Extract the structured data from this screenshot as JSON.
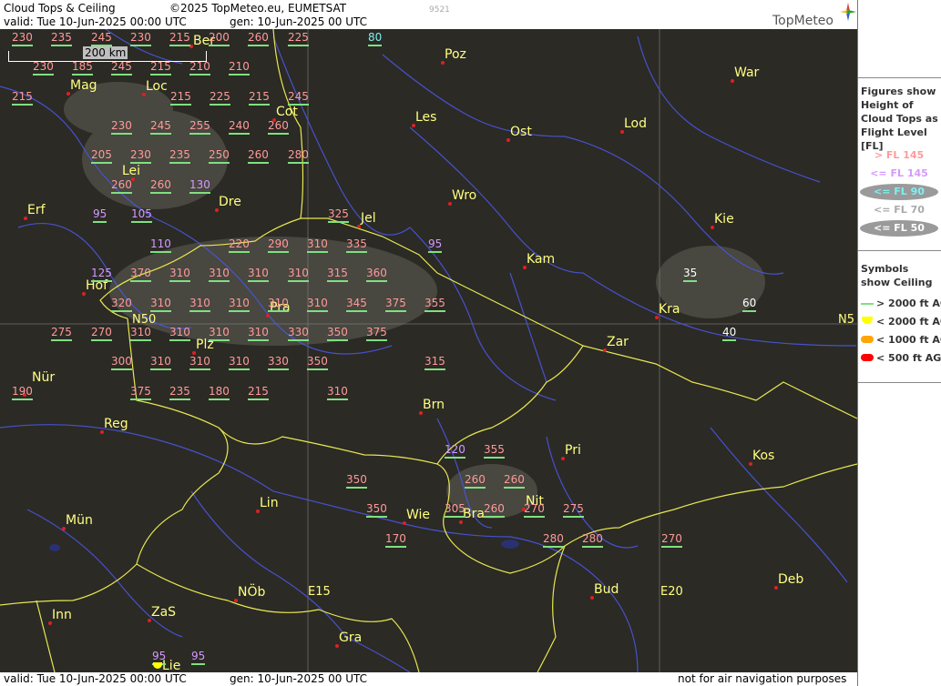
{
  "header": {
    "title": "Cloud Tops & Ceiling",
    "copyright": "©2025 TopMeteo.eu, EUMETSAT",
    "image_code": "9521",
    "valid": "valid:   Tue   10-Jun-2025   00:00 UTC",
    "generated": "gen: 10-Jun-2025 00 UTC",
    "brand": "TopMeteo"
  },
  "footer": {
    "valid": "valid:   Tue   10-Jun-2025   00:00 UTC",
    "generated": "gen: 10-Jun-2025 00 UTC",
    "disclaimer": "not for air navigation purposes"
  },
  "scale": {
    "label": "200 km"
  },
  "graticule": {
    "n50": "N50",
    "n50_right": "N5",
    "e15": "E15",
    "e20": "E20"
  },
  "colors": {
    "high": "#ff9a9a",
    "mid": "#d39aff",
    "low": "#7ff0f0",
    "lower": "#ffffff",
    "ceiling_ok": "#80e080",
    "ceiling_2000": "#ffff00",
    "ceiling_1000": "#ffa500",
    "ceiling_500": "#ff0000"
  },
  "cities": [
    {
      "name": "Ber"
    },
    {
      "name": "Poz"
    },
    {
      "name": "War"
    },
    {
      "name": "Mag"
    },
    {
      "name": "Loc"
    },
    {
      "name": "Cot"
    },
    {
      "name": "Les"
    },
    {
      "name": "Lod"
    },
    {
      "name": "Ost"
    },
    {
      "name": "Lei"
    },
    {
      "name": "Dre"
    },
    {
      "name": "Erf"
    },
    {
      "name": "Wro"
    },
    {
      "name": "Jel"
    },
    {
      "name": "Kie"
    },
    {
      "name": "Kam"
    },
    {
      "name": "Hof"
    },
    {
      "name": "Pra"
    },
    {
      "name": "Kra"
    },
    {
      "name": "Zar"
    },
    {
      "name": "Plz"
    },
    {
      "name": "Nür"
    },
    {
      "name": "Brn"
    },
    {
      "name": "Reg"
    },
    {
      "name": "Pri"
    },
    {
      "name": "Kos"
    },
    {
      "name": "Lin"
    },
    {
      "name": "Nit"
    },
    {
      "name": "Wie"
    },
    {
      "name": "Bra"
    },
    {
      "name": "Mün"
    },
    {
      "name": "NÖb"
    },
    {
      "name": "Bud"
    },
    {
      "name": "Deb"
    },
    {
      "name": "Inn"
    },
    {
      "name": "ZaS"
    },
    {
      "name": "Gra"
    },
    {
      "name": "Lie"
    }
  ],
  "cloud_tops": [
    {
      "v": "230",
      "c": "pink"
    },
    {
      "v": "235",
      "c": "pink"
    },
    {
      "v": "245",
      "c": "pink"
    },
    {
      "v": "230",
      "c": "pink"
    },
    {
      "v": "215",
      "c": "pink"
    },
    {
      "v": "200",
      "c": "pink"
    },
    {
      "v": "260",
      "c": "pink"
    },
    {
      "v": "225",
      "c": "pink"
    },
    {
      "v": "80",
      "c": "cyan"
    },
    {
      "v": "230",
      "c": "pink"
    },
    {
      "v": "185",
      "c": "pink"
    },
    {
      "v": "245",
      "c": "pink"
    },
    {
      "v": "215",
      "c": "pink"
    },
    {
      "v": "210",
      "c": "pink"
    },
    {
      "v": "210",
      "c": "pink"
    },
    {
      "v": "215",
      "c": "pink"
    },
    {
      "v": "215",
      "c": "pink"
    },
    {
      "v": "225",
      "c": "pink"
    },
    {
      "v": "215",
      "c": "pink"
    },
    {
      "v": "245",
      "c": "pink"
    },
    {
      "v": "230",
      "c": "pink"
    },
    {
      "v": "245",
      "c": "pink"
    },
    {
      "v": "255",
      "c": "pink"
    },
    {
      "v": "240",
      "c": "pink"
    },
    {
      "v": "260",
      "c": "pink"
    },
    {
      "v": "205",
      "c": "pink"
    },
    {
      "v": "230",
      "c": "pink"
    },
    {
      "v": "235",
      "c": "pink"
    },
    {
      "v": "250",
      "c": "pink"
    },
    {
      "v": "260",
      "c": "pink"
    },
    {
      "v": "280",
      "c": "pink"
    },
    {
      "v": "260",
      "c": "pink"
    },
    {
      "v": "260",
      "c": "pink"
    },
    {
      "v": "130",
      "c": "violet"
    },
    {
      "v": "95",
      "c": "violet"
    },
    {
      "v": "105",
      "c": "violet"
    },
    {
      "v": "325",
      "c": "pink"
    },
    {
      "v": "110",
      "c": "violet"
    },
    {
      "v": "220",
      "c": "pink"
    },
    {
      "v": "290",
      "c": "pink"
    },
    {
      "v": "310",
      "c": "pink"
    },
    {
      "v": "335",
      "c": "pink"
    },
    {
      "v": "95",
      "c": "violet"
    },
    {
      "v": "125",
      "c": "violet"
    },
    {
      "v": "370",
      "c": "pink"
    },
    {
      "v": "310",
      "c": "pink"
    },
    {
      "v": "310",
      "c": "pink"
    },
    {
      "v": "310",
      "c": "pink"
    },
    {
      "v": "310",
      "c": "pink"
    },
    {
      "v": "315",
      "c": "pink"
    },
    {
      "v": "360",
      "c": "pink"
    },
    {
      "v": "35",
      "c": "white"
    },
    {
      "v": "320",
      "c": "pink"
    },
    {
      "v": "310",
      "c": "pink"
    },
    {
      "v": "310",
      "c": "pink"
    },
    {
      "v": "310",
      "c": "pink"
    },
    {
      "v": "310",
      "c": "pink"
    },
    {
      "v": "310",
      "c": "pink"
    },
    {
      "v": "345",
      "c": "pink"
    },
    {
      "v": "375",
      "c": "pink"
    },
    {
      "v": "355",
      "c": "pink"
    },
    {
      "v": "60",
      "c": "white"
    },
    {
      "v": "275",
      "c": "pink"
    },
    {
      "v": "270",
      "c": "pink"
    },
    {
      "v": "310",
      "c": "pink"
    },
    {
      "v": "310",
      "c": "pink"
    },
    {
      "v": "310",
      "c": "pink"
    },
    {
      "v": "310",
      "c": "pink"
    },
    {
      "v": "330",
      "c": "pink"
    },
    {
      "v": "350",
      "c": "pink"
    },
    {
      "v": "375",
      "c": "pink"
    },
    {
      "v": "40",
      "c": "white"
    },
    {
      "v": "300",
      "c": "pink"
    },
    {
      "v": "310",
      "c": "pink"
    },
    {
      "v": "310",
      "c": "pink"
    },
    {
      "v": "310",
      "c": "pink"
    },
    {
      "v": "330",
      "c": "pink"
    },
    {
      "v": "350",
      "c": "pink"
    },
    {
      "v": "315",
      "c": "pink"
    },
    {
      "v": "190",
      "c": "pink"
    },
    {
      "v": "375",
      "c": "pink"
    },
    {
      "v": "235",
      "c": "pink"
    },
    {
      "v": "180",
      "c": "pink"
    },
    {
      "v": "215",
      "c": "pink"
    },
    {
      "v": "310",
      "c": "pink"
    },
    {
      "v": "120",
      "c": "violet"
    },
    {
      "v": "355",
      "c": "pink"
    },
    {
      "v": "350",
      "c": "pink"
    },
    {
      "v": "260",
      "c": "pink"
    },
    {
      "v": "260",
      "c": "pink"
    },
    {
      "v": "350",
      "c": "pink"
    },
    {
      "v": "305",
      "c": "pink"
    },
    {
      "v": "260",
      "c": "pink"
    },
    {
      "v": "270",
      "c": "pink"
    },
    {
      "v": "275",
      "c": "pink"
    },
    {
      "v": "170",
      "c": "pink"
    },
    {
      "v": "280",
      "c": "pink"
    },
    {
      "v": "280",
      "c": "pink"
    },
    {
      "v": "270",
      "c": "pink"
    },
    {
      "v": "95",
      "c": "violet"
    },
    {
      "v": "95",
      "c": "violet"
    }
  ],
  "sidebar": {
    "figures_title": "Figures show Height of Cloud Tops as Flight Level  [FL]",
    "legend": [
      {
        "label": "> FL 145"
      },
      {
        "label": "<= FL 145"
      },
      {
        "label": "<= FL 90"
      },
      {
        "label": "<= FL 70"
      },
      {
        "label": "<= FL 50"
      }
    ],
    "symbols_title": "Symbols show Ceiling",
    "symbols": [
      {
        "label": "> 2000 ft AGL"
      },
      {
        "label": "< 2000 ft AGL"
      },
      {
        "label": "< 1000 ft AGL"
      },
      {
        "label": "< 500 ft AGL"
      }
    ]
  }
}
